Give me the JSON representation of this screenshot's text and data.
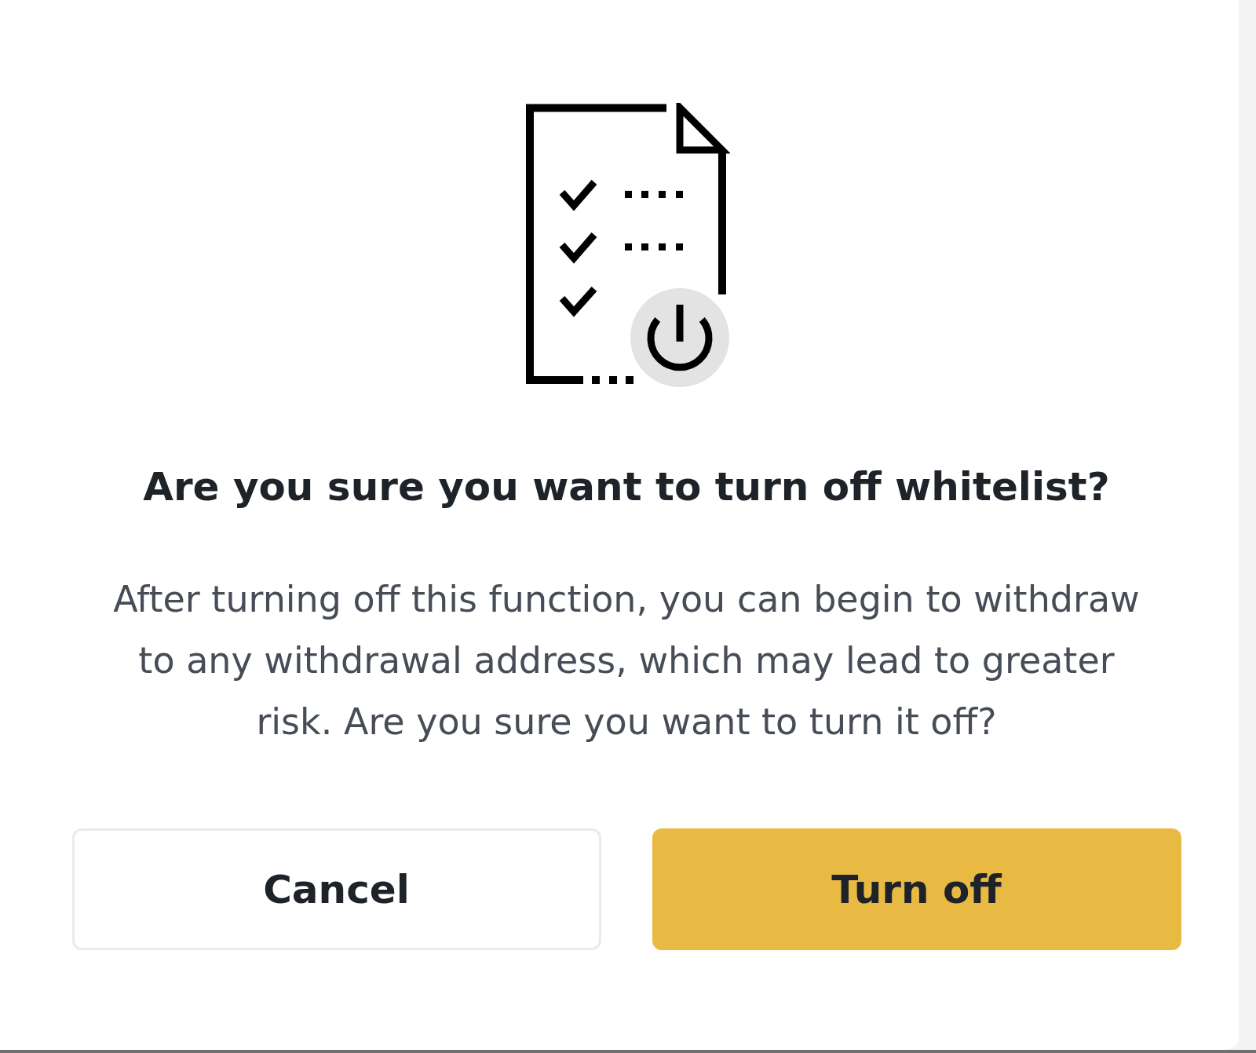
{
  "dialog": {
    "title": "Are you sure you want to turn off whitelist?",
    "message": "After turning off this function, you can begin to withdraw to any withdrawal address, which may lead to greater risk. Are you sure you want to turn it off?",
    "buttons": [
      {
        "label": "Cancel",
        "kind": "secondary"
      },
      {
        "label": "Turn off",
        "kind": "primary"
      }
    ]
  }
}
